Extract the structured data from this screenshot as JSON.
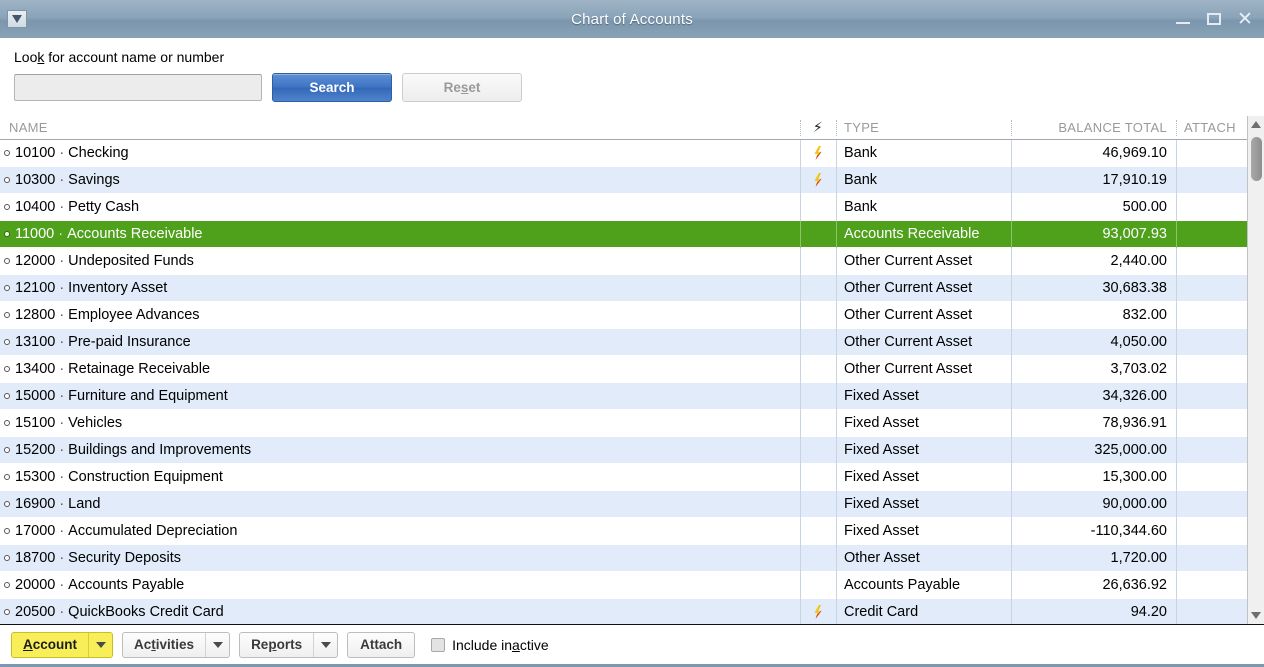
{
  "window": {
    "title": "Chart of Accounts",
    "sysmenu_icon": "window-menu-icon",
    "minimize_icon": "minimize-icon",
    "maximize_icon": "maximize-icon",
    "close_icon": "close-icon",
    "close_glyph": "✕"
  },
  "search": {
    "label_pre": "Loo",
    "label_accel": "k",
    "label_post": " for account name or number",
    "input_value": "",
    "input_placeholder": "",
    "search_label": "Search",
    "reset_pre": "Re",
    "reset_accel": "s",
    "reset_post": "et"
  },
  "table": {
    "columns": {
      "name": "NAME",
      "bolt": "⚡",
      "type": "TYPE",
      "balance": "BALANCE TOTAL",
      "attach": "ATTACH"
    },
    "rows": [
      {
        "num": "10100",
        "name": "Checking",
        "type": "Bank",
        "balance": "46,969.10",
        "bolt": true,
        "selected": false
      },
      {
        "num": "10300",
        "name": "Savings",
        "type": "Bank",
        "balance": "17,910.19",
        "bolt": true,
        "selected": false
      },
      {
        "num": "10400",
        "name": "Petty Cash",
        "type": "Bank",
        "balance": "500.00",
        "bolt": false,
        "selected": false
      },
      {
        "num": "11000",
        "name": "Accounts Receivable",
        "type": "Accounts Receivable",
        "balance": "93,007.93",
        "bolt": false,
        "selected": true
      },
      {
        "num": "12000",
        "name": "Undeposited Funds",
        "type": "Other Current Asset",
        "balance": "2,440.00",
        "bolt": false,
        "selected": false
      },
      {
        "num": "12100",
        "name": "Inventory Asset",
        "type": "Other Current Asset",
        "balance": "30,683.38",
        "bolt": false,
        "selected": false
      },
      {
        "num": "12800",
        "name": "Employee Advances",
        "type": "Other Current Asset",
        "balance": "832.00",
        "bolt": false,
        "selected": false
      },
      {
        "num": "13100",
        "name": "Pre-paid Insurance",
        "type": "Other Current Asset",
        "balance": "4,050.00",
        "bolt": false,
        "selected": false
      },
      {
        "num": "13400",
        "name": "Retainage Receivable",
        "type": "Other Current Asset",
        "balance": "3,703.02",
        "bolt": false,
        "selected": false
      },
      {
        "num": "15000",
        "name": "Furniture and Equipment",
        "type": "Fixed Asset",
        "balance": "34,326.00",
        "bolt": false,
        "selected": false
      },
      {
        "num": "15100",
        "name": "Vehicles",
        "type": "Fixed Asset",
        "balance": "78,936.91",
        "bolt": false,
        "selected": false
      },
      {
        "num": "15200",
        "name": "Buildings and Improvements",
        "type": "Fixed Asset",
        "balance": "325,000.00",
        "bolt": false,
        "selected": false
      },
      {
        "num": "15300",
        "name": "Construction Equipment",
        "type": "Fixed Asset",
        "balance": "15,300.00",
        "bolt": false,
        "selected": false
      },
      {
        "num": "16900",
        "name": "Land",
        "type": "Fixed Asset",
        "balance": "90,000.00",
        "bolt": false,
        "selected": false
      },
      {
        "num": "17000",
        "name": "Accumulated Depreciation",
        "type": "Fixed Asset",
        "balance": "-110,344.60",
        "bolt": false,
        "selected": false
      },
      {
        "num": "18700",
        "name": "Security Deposits",
        "type": "Other Asset",
        "balance": "1,720.00",
        "bolt": false,
        "selected": false
      },
      {
        "num": "20000",
        "name": "Accounts Payable",
        "type": "Accounts Payable",
        "balance": "26,636.92",
        "bolt": false,
        "selected": false
      },
      {
        "num": "20500",
        "name": "QuickBooks Credit Card",
        "type": "Credit Card",
        "balance": "94.20",
        "bolt": true,
        "selected": false
      }
    ],
    "separator": "·"
  },
  "toolbar": {
    "account_pre": "",
    "account_accel": "A",
    "account_post": "ccount",
    "activities_pre": "Ac",
    "activities_accel": "t",
    "activities_post": "ivities",
    "reports_pre": "Re",
    "reports_accel": "p",
    "reports_post": "orts",
    "attach_label": "Attach",
    "include_inactive_pre": "Include in",
    "include_inactive_accel": "a",
    "include_inactive_post": "ctive",
    "include_inactive_checked": false
  },
  "colors": {
    "selection_green": "#4fa01b",
    "row_stripe": "#e1ebfa",
    "title_blue": "#8ba4b9",
    "search_button": "#3f74c4",
    "focus_yellow": "#f7ee5a"
  }
}
